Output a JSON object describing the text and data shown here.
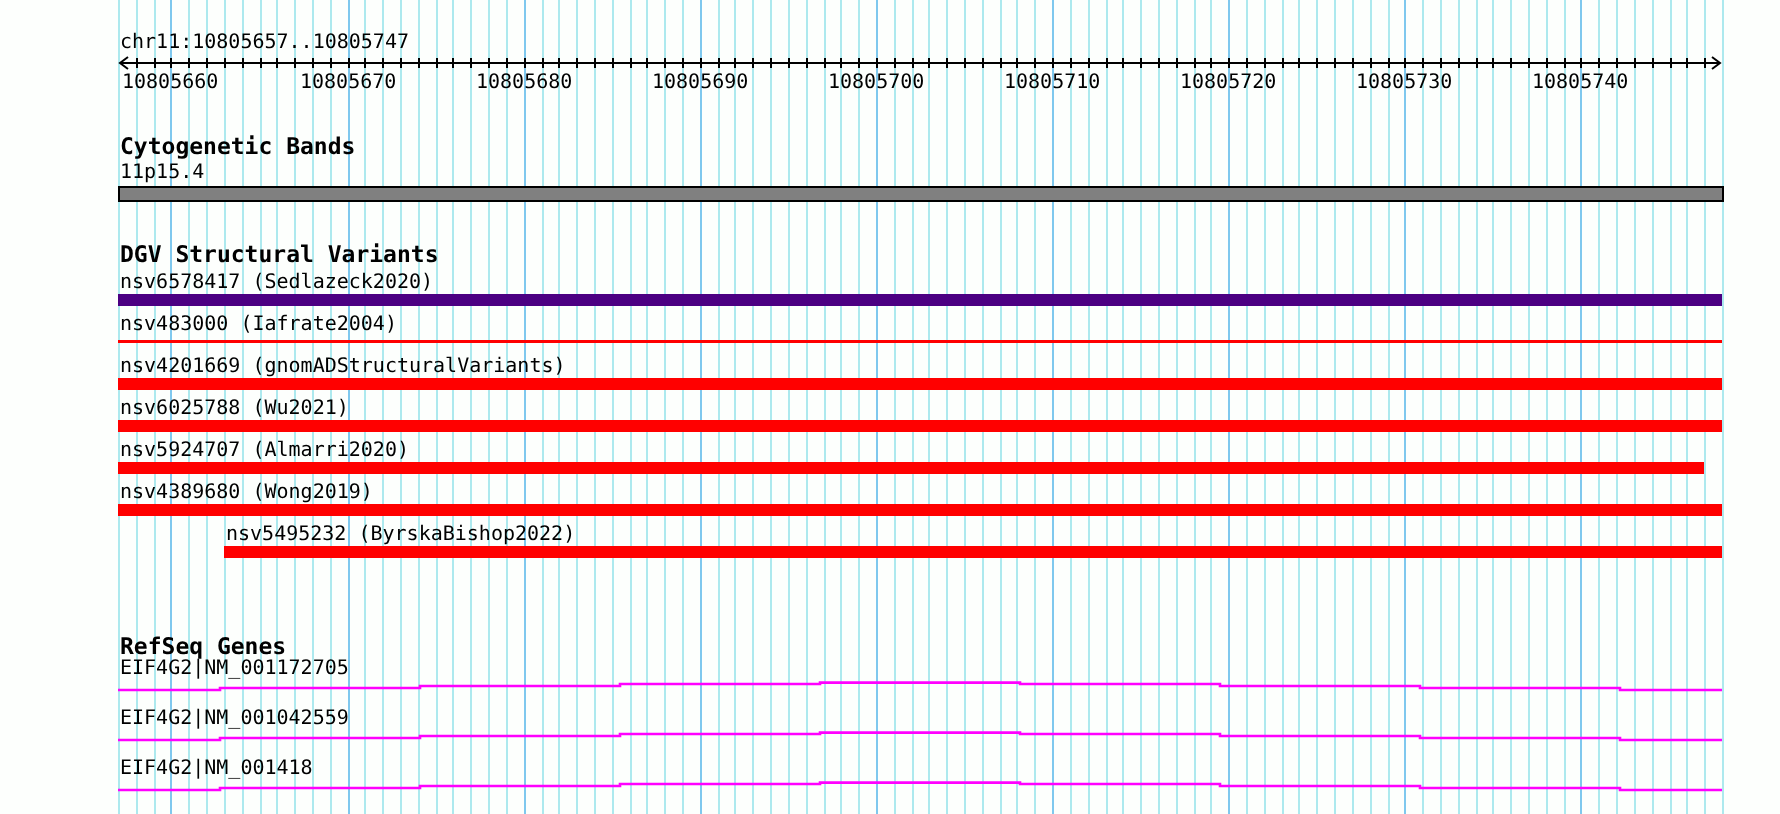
{
  "ruler": {
    "location": "chr11:10805657..10805747",
    "ticks": [
      "10805660",
      "10805670",
      "10805680",
      "10805690",
      "10805700",
      "10805710",
      "10805720",
      "10805730",
      "10805740"
    ]
  },
  "cytogenetic_bands": {
    "title": "Cytogenetic Bands",
    "band": "11p15.4"
  },
  "dgv_structural_variants": {
    "title": "DGV Structural Variants",
    "features": [
      {
        "label": "nsv6578417 (Sedlazeck2020)",
        "color": "#4b0082",
        "kind": "thick",
        "cut_left": true,
        "cut_right": true
      },
      {
        "label": "nsv483000 (Iafrate2004)",
        "color": "#ff0000",
        "kind": "thin",
        "cut_left": true,
        "cut_right": true
      },
      {
        "label": "nsv4201669 (gnomADStructuralVariants)",
        "color": "#ff0000",
        "kind": "thick",
        "cut_left": true,
        "cut_right": true
      },
      {
        "label": "nsv6025788 (Wu2021)",
        "color": "#ff0000",
        "kind": "thick",
        "cut_left": true,
        "cut_right": true
      },
      {
        "label": "nsv5924707 (Almarri2020)",
        "color": "#ff0000",
        "kind": "thick",
        "cut_left": true,
        "cut_right": false
      },
      {
        "label": "nsv4389680 (Wong2019)",
        "color": "#ff0000",
        "kind": "thick",
        "cut_left": true,
        "cut_right": true
      },
      {
        "label": "nsv5495232 (ByrskaBishop2022)",
        "color": "#ff0000",
        "kind": "thick",
        "cut_left": false,
        "cut_right": true
      }
    ]
  },
  "refseq_genes": {
    "title": "RefSeq Genes",
    "transcripts": [
      {
        "label": "EIF4G2|NM_001172705"
      },
      {
        "label": "EIF4G2|NM_001042559"
      },
      {
        "label": "EIF4G2|NM_001418"
      }
    ]
  }
}
